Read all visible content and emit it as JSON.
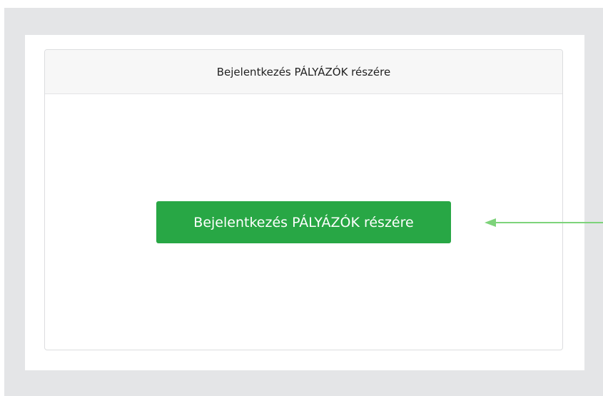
{
  "login_card": {
    "header_title": "Bejelentkezés PÁLYÁZÓK részére",
    "login_button_label": "Bejelentkezés PÁLYÁZÓK részére"
  },
  "colors": {
    "backdrop": "#e4e5e7",
    "card_header": "#f7f7f7",
    "login_button": "#28a745",
    "arrow": "#7dd37a"
  },
  "icons": {
    "pointer_arrow": "arrow-left-icon"
  }
}
